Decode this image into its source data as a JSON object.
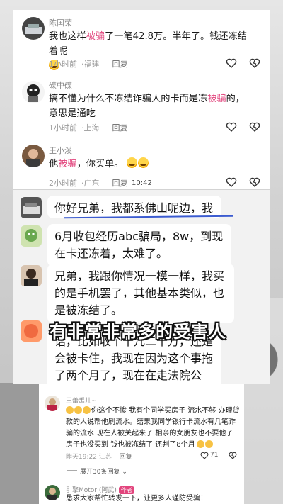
{
  "top_comments": [
    {
      "name": "陈国荣",
      "text_pre": "我也这样",
      "text_red": "被骗",
      "text_post": "了一笔42.8万。半年了。钱还冻结着呢",
      "time": "1小时前",
      "location": "福建",
      "reply": "回复"
    },
    {
      "name": "碟中碟",
      "text_pre": "搞不懂为什么不冻结诈骗人的卡而是冻",
      "text_red": "被骗",
      "text_post": "的，意思是通吃",
      "time": "1小时前",
      "location": "上海",
      "reply": "回复"
    },
    {
      "name": "王小溪",
      "text_pre": "他",
      "text_red": "被骗",
      "text_post": "，你买单。",
      "time": "2小时前",
      "location": "广东",
      "reply": "回复"
    }
  ],
  "video_timestamp": "10:42",
  "chat_messages": [
    {
      "text": "你好兄弟，我都系佛山呢边，我也是"
    },
    {
      "text": "6月收包经历abc骗局，8w，到现在卡还冻着，太难了。"
    },
    {
      "text": "兄弟，我跟你情况一模一样，我买的是手机罢了，其他基本类似，也是被冻结了。"
    },
    {
      "text": "话，比如收个十几二十万，还是会被卡住，我现在因为这个事拖了两个月了，现在在走法院公证。"
    }
  ],
  "caption": "有非常非常多的受害人",
  "bottom_comment": {
    "name": "王蕾禹儿~",
    "text": "你这个不惨 我有个同学买房子 流水不够 办理贷款的人说帮他刷流水。结果我同学银行卡流水有几笔诈骗的流水 现在人被关起来了 相亲的女朋友也不要他了 房子也没买到 钱也被冻结了 还判了8个月",
    "time": "昨天19:22",
    "location": "江苏",
    "reply": "回复",
    "likes": "71",
    "expand": "展开30条回复"
  },
  "author_comment": {
    "name": "引擎Motor (阿武)",
    "tag": "作者",
    "text": "恳求大家帮忙转发一下，让更多人谨防受骗！"
  },
  "colors": {
    "highlight": "#e2457d",
    "caption_stroke": "#111111"
  }
}
